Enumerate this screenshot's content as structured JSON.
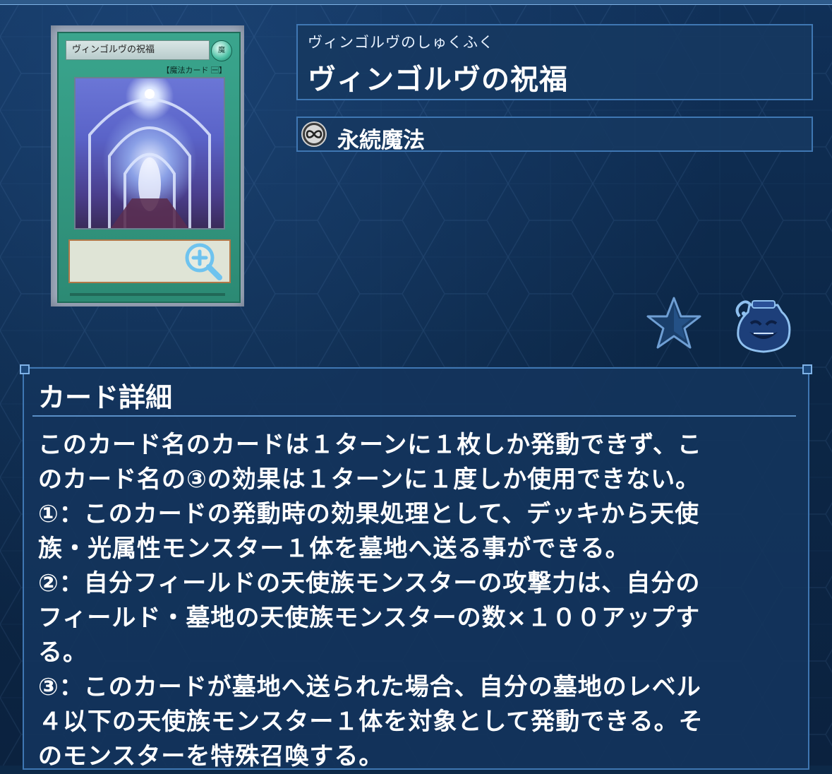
{
  "card": {
    "art_name": "ヴィンゴルヴの祝福",
    "art_attribute": "魔",
    "art_type": "【魔法カード 🈩】",
    "zoom_icon": "zoom-in-icon"
  },
  "header": {
    "ruby": "ヴィンゴルヴのしゅくふく",
    "name": "ヴィンゴルヴの祝福",
    "type_icon": "continuous-infinity-icon",
    "type_label": "永続魔法"
  },
  "actions": {
    "favorite_icon": "star-icon",
    "pot_icon": "pot-icon"
  },
  "details": {
    "title": "カード詳細",
    "lines": [
      "このカード名のカードは１ターンに１枚しか発動できず、こ",
      "のカード名の③の効果は１ターンに１度しか使用できない。",
      "①：このカードの発動時の効果処理として、デッキから天使",
      "族・光属性モンスター１体を墓地へ送る事ができる。",
      "②：自分フィールドの天使族モンスターの攻撃力は、自分の",
      "フィールド・墓地の天使族モンスターの数×１００アップす",
      "る。",
      "③：このカードが墓地へ送られた場合、自分の墓地のレベル",
      "４以下の天使族モンスター１体を対象として発動できる。そ",
      "のモンスターを特殊召喚する。"
    ]
  },
  "colors": {
    "background": "#0d2948",
    "panel_border": "#3f77b3",
    "card_green": "#3aa58d"
  }
}
